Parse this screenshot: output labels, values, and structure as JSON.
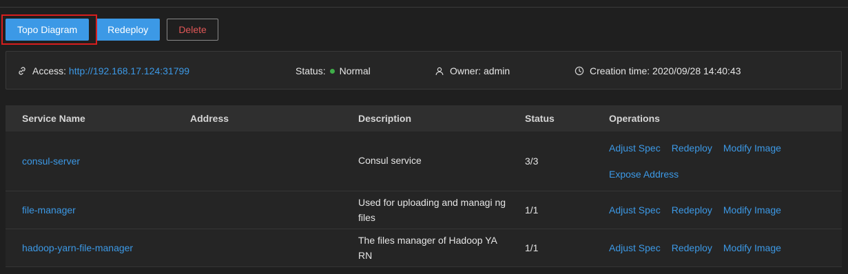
{
  "toolbar": {
    "topo_label": "Topo Diagram",
    "redeploy_label": "Redeploy",
    "delete_label": "Delete"
  },
  "info": {
    "access_label": "Access:",
    "access_url": "http://192.168.17.124:31799",
    "status_label": "Status:",
    "status_value": "Normal",
    "status_color": "#3fae49",
    "owner_label": "Owner: admin",
    "creation_label": "Creation time: 2020/09/28 14:40:43"
  },
  "table": {
    "headers": [
      "Service Name",
      "Address",
      "Description",
      "Status",
      "Operations"
    ],
    "rows": [
      {
        "name": "consul-server",
        "address": "",
        "description": "Consul service",
        "status": "3/3",
        "ops": [
          "Adjust Spec",
          "Redeploy",
          "Modify Image",
          "Expose Address"
        ]
      },
      {
        "name": "file-manager",
        "address": "",
        "description": "Used for uploading and managi ng files",
        "status": "1/1",
        "ops": [
          "Adjust Spec",
          "Redeploy",
          "Modify Image"
        ]
      },
      {
        "name": "hadoop-yarn-file-manager",
        "address": "",
        "description": "The files manager of Hadoop YA RN",
        "status": "1/1",
        "ops": [
          "Adjust Spec",
          "Redeploy",
          "Modify Image"
        ]
      }
    ]
  },
  "colors": {
    "accent": "#3c99e6",
    "danger": "#e05757",
    "highlight": "#d81e1e"
  }
}
